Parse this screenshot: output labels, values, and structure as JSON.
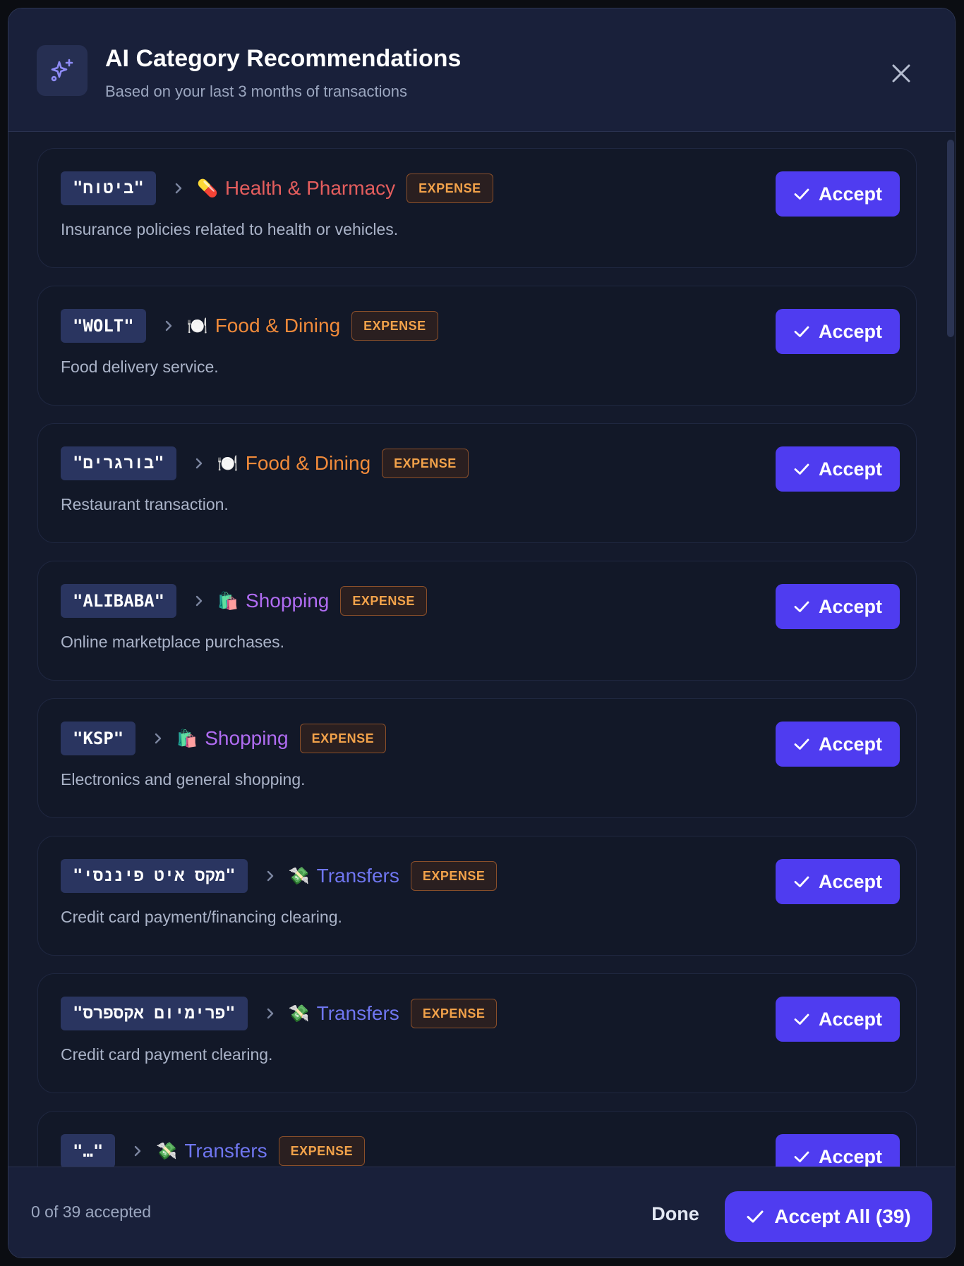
{
  "header": {
    "title": "AI Category Recommendations",
    "subtitle": "Based on your last 3 months of transactions",
    "icon": "sparkles-icon",
    "close_icon": "close-icon"
  },
  "accept_label": "Accept",
  "recommendations": [
    {
      "merchant": "\"ביטוח\"",
      "category": "Health & Pharmacy",
      "emoji": "💊",
      "color": "#e35d5d",
      "type": "EXPENSE",
      "description": "Insurance policies related to health or vehicles."
    },
    {
      "merchant": "\"WOLT\"",
      "category": "Food & Dining",
      "emoji": "🍽️",
      "color": "#f08a3a",
      "type": "EXPENSE",
      "description": "Food delivery service."
    },
    {
      "merchant": "\"בורגרים\"",
      "category": "Food & Dining",
      "emoji": "🍽️",
      "color": "#f08a3a",
      "type": "EXPENSE",
      "description": "Restaurant transaction."
    },
    {
      "merchant": "\"ALIBABA\"",
      "category": "Shopping",
      "emoji": "🛍️",
      "color": "#b06cf2",
      "type": "EXPENSE",
      "description": "Online marketplace purchases."
    },
    {
      "merchant": "\"KSP\"",
      "category": "Shopping",
      "emoji": "🛍️",
      "color": "#b06cf2",
      "type": "EXPENSE",
      "description": "Electronics and general shopping."
    },
    {
      "merchant": "\"מקס איט פיננסי\"",
      "category": "Transfers",
      "emoji": "💸",
      "color": "#6f76f0",
      "type": "EXPENSE",
      "description": "Credit card payment/financing clearing."
    },
    {
      "merchant": "\"פרימיום אקספרס\"",
      "category": "Transfers",
      "emoji": "💸",
      "color": "#6f76f0",
      "type": "EXPENSE",
      "description": "Credit card payment clearing."
    },
    {
      "merchant": "\"…\"",
      "category": "Transfers",
      "emoji": "💸",
      "color": "#6f76f0",
      "type": "EXPENSE",
      "description": ""
    }
  ],
  "footer": {
    "accepted_count": "0 of 39 accepted",
    "done_label": "Done",
    "accept_all_label": "Accept All (39)"
  },
  "colors": {
    "accent": "#4f3cf0",
    "badge_text": "#f2a24a"
  }
}
